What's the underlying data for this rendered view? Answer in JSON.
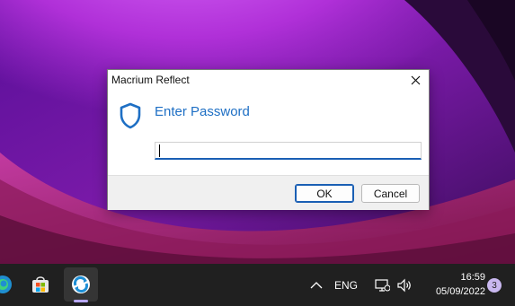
{
  "dialog": {
    "title": "Macrium Reflect",
    "heading": "Enter Password",
    "password_value": "",
    "ok_label": "OK",
    "cancel_label": "Cancel"
  },
  "taskbar": {
    "language": "ENG",
    "time": "16:59",
    "date": "05/09/2022",
    "notification_count": "3",
    "apps": [
      "edge-icon",
      "microsoft-store-icon",
      "macrium-reflect-icon"
    ]
  },
  "colors": {
    "accent": "#1a5fb4",
    "heading": "#1e6fc4",
    "taskbar": "#202020",
    "dialog_footer": "#f0f0f0"
  }
}
